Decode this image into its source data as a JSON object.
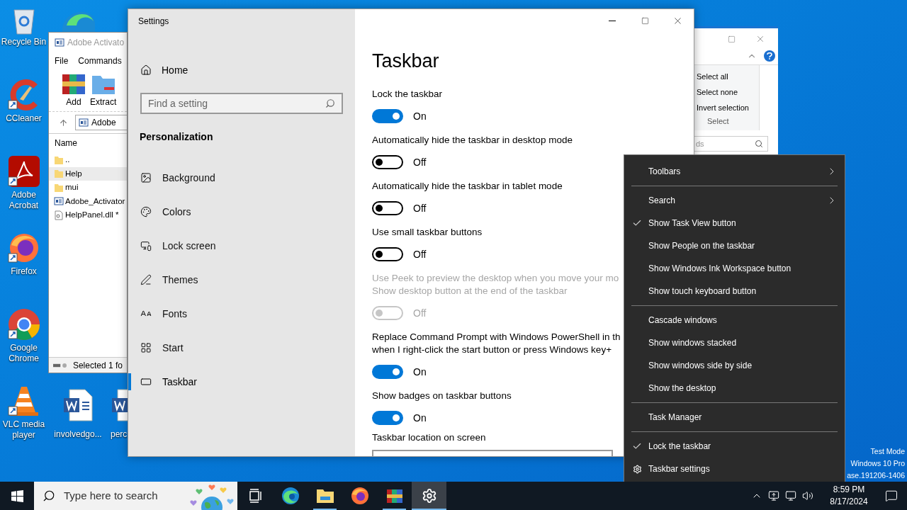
{
  "desktop_icons": [
    {
      "label": "Recycle Bin",
      "kind": "recycle"
    },
    {
      "label": "CCleaner",
      "kind": "ccleaner"
    },
    {
      "label": "Adobe Acrobat",
      "kind": "acrobat"
    },
    {
      "label": "Firefox",
      "kind": "firefox"
    },
    {
      "label": "Google Chrome",
      "kind": "chrome"
    },
    {
      "label": "VLC media player",
      "kind": "vlc"
    }
  ],
  "desktop_files": [
    {
      "label": "involvedgo...",
      "kind": "word"
    },
    {
      "label": "perc",
      "kind": "word"
    }
  ],
  "winrar_window": {
    "title": "Adobe Activato",
    "menu": [
      "File",
      "Commands"
    ],
    "toolbar": [
      {
        "label": "Add",
        "kind": "add"
      },
      {
        "label": "Extract",
        "kind": "extract"
      }
    ],
    "address": "Adobe",
    "column": "Name",
    "files": [
      {
        "name": "..",
        "kind": "folder",
        "selected": false
      },
      {
        "name": "Help",
        "kind": "folder",
        "selected": true
      },
      {
        "name": "mui",
        "kind": "folder",
        "selected": false
      },
      {
        "name": "Adobe_Activator",
        "kind": "exe",
        "selected": false
      },
      {
        "name": "HelpPanel.dll *",
        "kind": "dll",
        "selected": false
      }
    ],
    "status": "Selected 1 fo"
  },
  "explorer_window": {
    "ribbon": [
      "Select all",
      "Select none",
      "Invert selection"
    ],
    "group": "Select",
    "search_placeholder": "ds"
  },
  "settings": {
    "title": "Settings",
    "home": "Home",
    "search_placeholder": "Find a setting",
    "section": "Personalization",
    "nav": [
      {
        "label": "Background",
        "kind": "background",
        "selected": false
      },
      {
        "label": "Colors",
        "kind": "colors",
        "selected": false
      },
      {
        "label": "Lock screen",
        "kind": "lock",
        "selected": false
      },
      {
        "label": "Themes",
        "kind": "themes",
        "selected": false
      },
      {
        "label": "Fonts",
        "kind": "fonts",
        "selected": false
      },
      {
        "label": "Start",
        "kind": "start",
        "selected": false
      },
      {
        "label": "Taskbar",
        "kind": "taskbar",
        "selected": true
      }
    ],
    "page_title": "Taskbar",
    "toggles": [
      {
        "lines": [
          "Lock the taskbar"
        ],
        "on": true,
        "state": "On",
        "disabled": false
      },
      {
        "lines": [
          "Automatically hide the taskbar in desktop mode"
        ],
        "on": false,
        "state": "Off",
        "disabled": false
      },
      {
        "lines": [
          "Automatically hide the taskbar in tablet mode"
        ],
        "on": false,
        "state": "Off",
        "disabled": false
      },
      {
        "lines": [
          "Use small taskbar buttons"
        ],
        "on": false,
        "state": "Off",
        "disabled": false
      },
      {
        "lines": [
          "Use Peek to preview the desktop when you move your mo",
          "Show desktop button at the end of the taskbar"
        ],
        "on": false,
        "state": "Off",
        "disabled": true
      },
      {
        "lines": [
          "Replace Command Prompt with Windows PowerShell in th",
          "when I right-click the start button or press Windows key+"
        ],
        "on": true,
        "state": "On",
        "disabled": false
      },
      {
        "lines": [
          "Show badges on taskbar buttons"
        ],
        "on": true,
        "state": "On",
        "disabled": false
      }
    ],
    "location_label": "Taskbar location on screen"
  },
  "context_menu": {
    "groups": [
      [
        {
          "label": "Toolbars",
          "kind": "submenu"
        }
      ],
      [
        {
          "label": "Search",
          "kind": "submenu"
        },
        {
          "label": "Show Task View button",
          "kind": "check",
          "checked": true
        },
        {
          "label": "Show People on the taskbar",
          "kind": "check",
          "checked": false
        },
        {
          "label": "Show Windows Ink Workspace button",
          "kind": "check",
          "checked": false
        },
        {
          "label": "Show touch keyboard button",
          "kind": "check",
          "checked": false
        }
      ],
      [
        {
          "label": "Cascade windows",
          "kind": "action"
        },
        {
          "label": "Show windows stacked",
          "kind": "action"
        },
        {
          "label": "Show windows side by side",
          "kind": "action"
        },
        {
          "label": "Show the desktop",
          "kind": "action"
        }
      ],
      [
        {
          "label": "Task Manager",
          "kind": "action"
        }
      ],
      [
        {
          "label": "Lock the taskbar",
          "kind": "check",
          "checked": true
        },
        {
          "label": "Taskbar settings",
          "kind": "settings"
        }
      ]
    ]
  },
  "system_info": [
    "Test Mode",
    "Windows 10 Pro",
    "ase.191206-1406"
  ],
  "taskbar": {
    "search_placeholder": "Type here to search",
    "apps": [
      {
        "kind": "taskview",
        "running": false,
        "selected": false
      },
      {
        "kind": "edge",
        "running": false,
        "selected": false
      },
      {
        "kind": "explorer",
        "running": true,
        "selected": false
      },
      {
        "kind": "firefox",
        "running": false,
        "selected": false
      },
      {
        "kind": "winrar",
        "running": true,
        "selected": false
      },
      {
        "kind": "settings",
        "running": true,
        "selected": true
      }
    ],
    "time": "8:59 PM",
    "date": "8/17/2024"
  }
}
